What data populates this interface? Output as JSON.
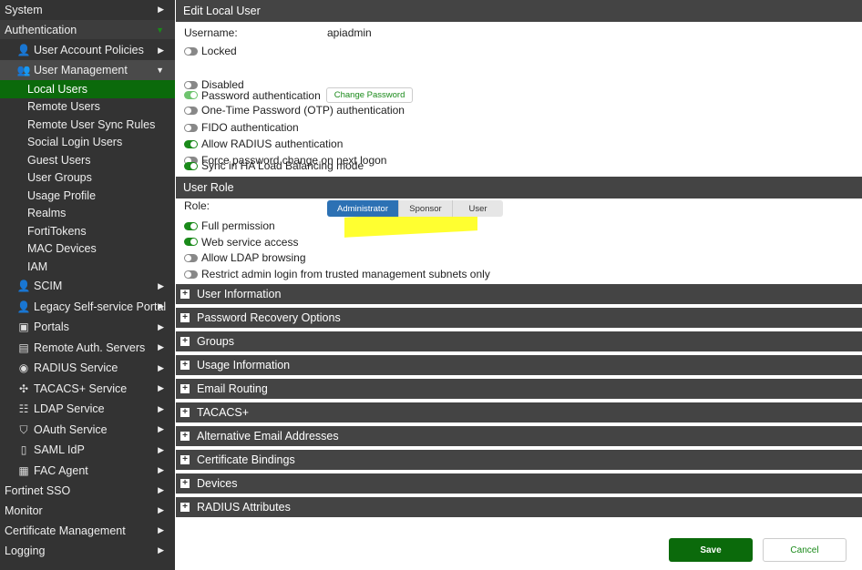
{
  "sidebar": {
    "top": [
      {
        "label": "System"
      },
      {
        "label": "Authentication"
      }
    ],
    "auth_items": [
      {
        "label": "User Account Policies",
        "icon": "user-wrench-icon"
      },
      {
        "label": "User Management",
        "icon": "users-icon"
      }
    ],
    "user_mgmt": [
      "Local Users",
      "Remote Users",
      "Remote User Sync Rules",
      "Social Login Users",
      "Guest Users",
      "User Groups",
      "Usage Profile",
      "Realms",
      "FortiTokens",
      "MAC Devices",
      "IAM"
    ],
    "more": [
      {
        "label": "SCIM",
        "icon": "user-sync-icon"
      },
      {
        "label": "Legacy Self-service Portal",
        "icon": "user-wrench-icon"
      },
      {
        "label": "Portals",
        "icon": "portal-icon"
      },
      {
        "label": "Remote Auth. Servers",
        "icon": "server-icon"
      },
      {
        "label": "RADIUS Service",
        "icon": "wifi-icon"
      },
      {
        "label": "TACACS+ Service",
        "icon": "network-icon"
      },
      {
        "label": "LDAP Service",
        "icon": "tree-icon"
      },
      {
        "label": "OAuth Service",
        "icon": "shield-icon"
      },
      {
        "label": "SAML IdP",
        "icon": "document-icon"
      },
      {
        "label": "FAC Agent",
        "icon": "agent-icon"
      }
    ],
    "bottom": [
      "Fortinet SSO",
      "Monitor",
      "Certificate Management",
      "Logging"
    ]
  },
  "form": {
    "title": "Edit Local User",
    "username_label": "Username:",
    "username": "apiadmin",
    "toggles": [
      {
        "label": "Locked",
        "on": false
      },
      {
        "label": "Disabled",
        "on": false
      },
      {
        "label": "Password authentication",
        "on": true
      },
      {
        "label": "One-Time Password (OTP) authentication",
        "on": false
      },
      {
        "label": "FIDO authentication",
        "on": false
      },
      {
        "label": "Allow RADIUS authentication",
        "on": true
      },
      {
        "label": "Force password change on next logon",
        "on": false
      },
      {
        "label": "Sync in HA Load Balancing mode",
        "on": true
      }
    ],
    "change_password": "Change Password",
    "role_title": "User Role",
    "role_label": "Role:",
    "roles": [
      "Administrator",
      "Sponsor",
      "User"
    ],
    "selected_role": "Administrator",
    "role_toggles": [
      {
        "label": "Full permission",
        "on": true
      },
      {
        "label": "Web service access",
        "on": true
      },
      {
        "label": "Allow LDAP browsing",
        "on": false
      },
      {
        "label": "Restrict admin login from trusted management subnets only",
        "on": false
      }
    ],
    "sections": [
      "User Information",
      "Password Recovery Options",
      "Groups",
      "Usage Information",
      "Email Routing",
      "TACACS+",
      "Alternative Email Addresses",
      "Certificate Bindings",
      "Devices",
      "RADIUS Attributes"
    ],
    "save": "Save",
    "cancel": "Cancel"
  },
  "colors": {
    "accent": "#0b6a0b",
    "selected_role": "#2c71b4",
    "highlight": "#ffff1a"
  }
}
